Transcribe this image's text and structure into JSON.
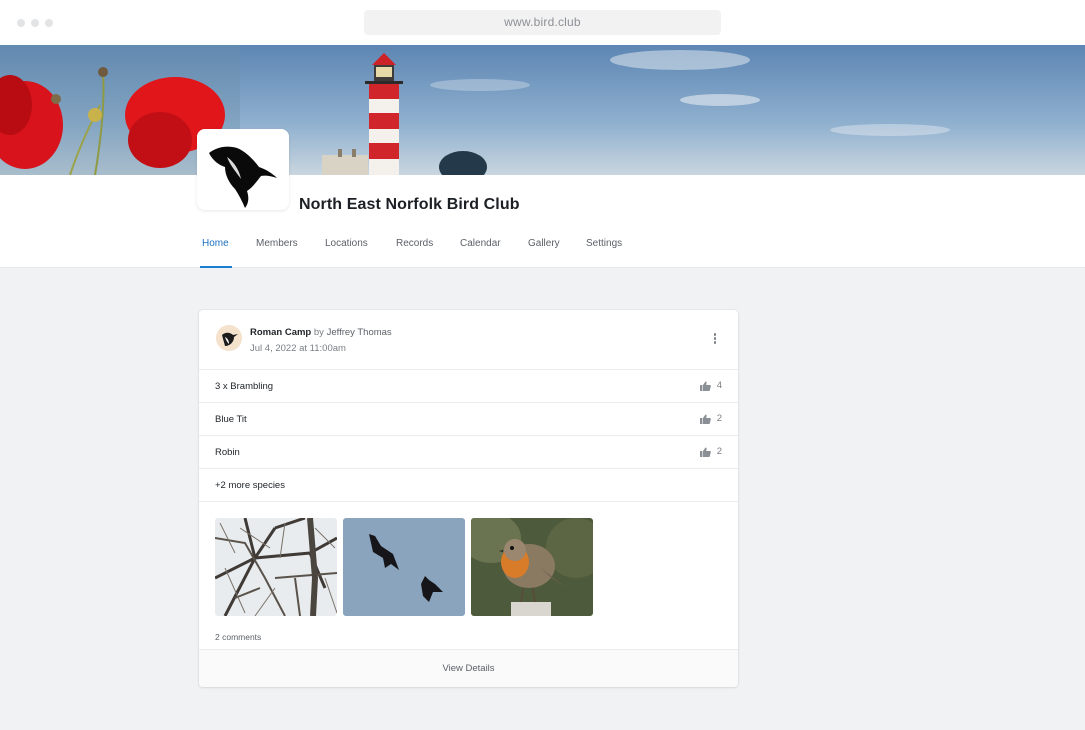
{
  "browser": {
    "url": "www.bird.club"
  },
  "club": {
    "name": "North East Norfolk Bird Club"
  },
  "tabs": [
    {
      "label": "Home",
      "active": true
    },
    {
      "label": "Members",
      "active": false
    },
    {
      "label": "Locations",
      "active": false
    },
    {
      "label": "Records",
      "active": false
    },
    {
      "label": "Calendar",
      "active": false
    },
    {
      "label": "Gallery",
      "active": false
    },
    {
      "label": "Settings",
      "active": false
    }
  ],
  "record": {
    "location": "Roman Camp",
    "by_text": "by",
    "author": "Jeffrey Thomas",
    "date": "Jul 4, 2022 at 11:00am",
    "species": [
      {
        "name": "3 x Brambling",
        "likes": "4"
      },
      {
        "name": "Blue Tit",
        "likes": "2"
      },
      {
        "name": "Robin",
        "likes": "2"
      }
    ],
    "more_species": "+2 more species",
    "photos": [
      "tree-branches-photo",
      "birds-of-prey-in-flight-photo",
      "robin-photo"
    ],
    "comments": "2 comments",
    "view_details": "View Details"
  },
  "colors": {
    "accent": "#1d7fd2",
    "page_bg": "#f1f2f4",
    "card_bg": "#ffffff"
  }
}
